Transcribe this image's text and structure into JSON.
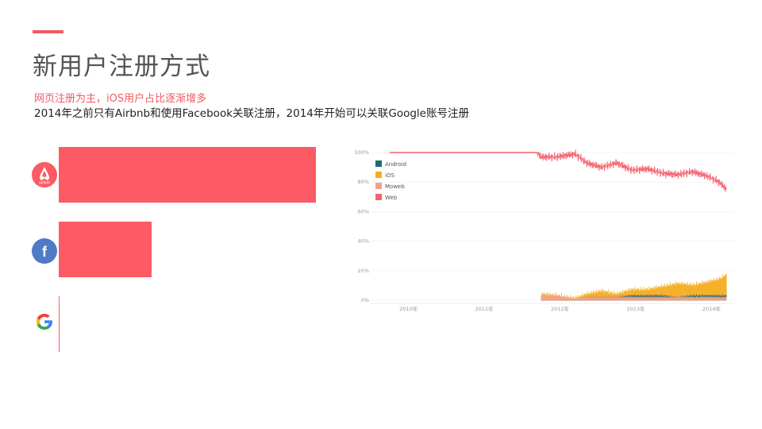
{
  "slide": {
    "title": "新用户注册方式",
    "subtitle": "网页注册为主，iOS用户占比逐渐增多",
    "description": "2014年之前只有Airbnb和使用Facebook关联注册，2014年开始可以关联Google账号注册"
  },
  "colors": {
    "accent": "#f05a62",
    "bar": "#fc5a64",
    "title": "#555555",
    "android": "#1b6b78",
    "ios": "#f6ad20",
    "moweb": "#f4a08a",
    "web": "#f4606c"
  },
  "chart_data": [
    {
      "type": "bar",
      "orientation": "horizontal",
      "categories": [
        "airbnb",
        "facebook",
        "google"
      ],
      "category_icons": [
        "airbnb-logo-icon",
        "facebook-logo-icon",
        "google-logo-icon"
      ],
      "values": [
        100,
        36,
        0
      ],
      "xlim": [
        0,
        100
      ],
      "icon_labels": {
        "airbnb": "airbnb",
        "facebook": "f"
      }
    },
    {
      "type": "area",
      "stacked": true,
      "stack_order": [
        "Android",
        "iOS",
        "Moweb",
        "Web"
      ],
      "x_tick_labels": [
        "2010年",
        "2011年",
        "2012年",
        "2013年",
        "2014年"
      ],
      "y_tick_labels": [
        "100%",
        "80%",
        "60%",
        "40%",
        "20%",
        "0%"
      ],
      "ylim": [
        0,
        100
      ],
      "xlim": [
        2009.75,
        2014.55
      ],
      "legend": {
        "placement": "top-left",
        "entries": [
          "Android",
          "iOS",
          "Moweb",
          "Web"
        ]
      },
      "grid": true,
      "series": [
        {
          "name": "Web",
          "color": "#f4606c",
          "x": [
            2010.0,
            2011.0,
            2011.95,
            2012.0,
            2012.2,
            2012.45,
            2012.6,
            2012.8,
            2013.0,
            2013.2,
            2013.4,
            2013.6,
            2013.8,
            2014.0,
            2014.2,
            2014.35,
            2014.45
          ],
          "y": [
            100,
            100,
            100,
            97,
            97,
            99,
            93,
            90,
            93,
            88,
            89,
            86,
            85,
            87,
            84,
            80,
            75
          ]
        },
        {
          "name": "Moweb",
          "color": "#f4a08a",
          "x": [
            2012.0,
            2012.2,
            2012.45,
            2012.6,
            2012.8,
            2013.0,
            2013.2,
            2013.4,
            2013.6,
            2013.8,
            2014.0,
            2014.2,
            2014.35,
            2014.45
          ],
          "y": [
            3,
            3,
            1,
            2,
            2,
            2,
            2,
            2,
            2,
            2,
            2,
            2,
            2,
            2
          ]
        },
        {
          "name": "iOS",
          "color": "#f6ad20",
          "x": [
            2012.0,
            2012.2,
            2012.45,
            2012.6,
            2012.8,
            2013.0,
            2013.2,
            2013.4,
            2013.6,
            2013.8,
            2014.0,
            2014.2,
            2014.35,
            2014.45
          ],
          "y": [
            4,
            3,
            1,
            4,
            6,
            4,
            7,
            7,
            9,
            11,
            10,
            12,
            14,
            17
          ]
        },
        {
          "name": "Android",
          "color": "#1b6b78",
          "x": [
            2012.0,
            2012.2,
            2012.45,
            2012.6,
            2012.8,
            2013.0,
            2013.2,
            2013.4,
            2013.6,
            2013.8,
            2014.0,
            2014.2,
            2014.35,
            2014.45
          ],
          "y": [
            0,
            0,
            0,
            2,
            2,
            2,
            3,
            3,
            3,
            2,
            3,
            3,
            3,
            3
          ]
        }
      ]
    }
  ]
}
